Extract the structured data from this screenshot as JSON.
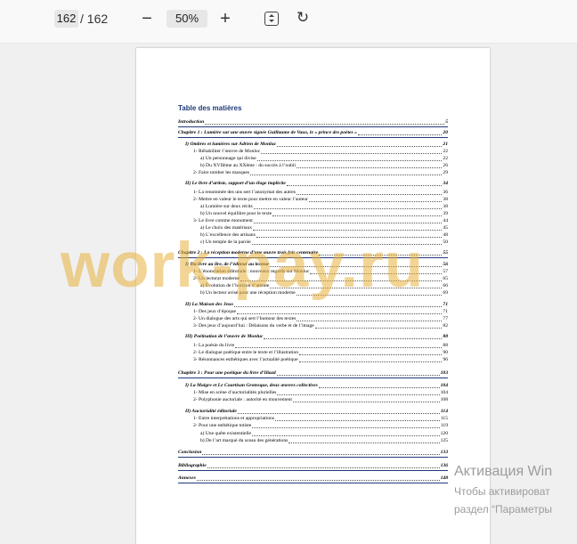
{
  "toolbar": {
    "page_current": "162",
    "page_separator": "/",
    "page_total": "162",
    "zoom_out_icon": "minus-icon",
    "zoom_level": "50%",
    "zoom_in_icon": "plus-icon",
    "fit_icon": "fit-page-icon",
    "rotate_icon": "rotate-icon"
  },
  "document": {
    "title": "Table des matières",
    "entries": [
      {
        "label": "Introduction",
        "page": "5",
        "kind": "chap"
      },
      {
        "label": "Chapitre 1 : Lumière sur une œuvre signée Guillaume de Vaux, le « prince des poètes »",
        "page": "20",
        "kind": "chap"
      },
      {
        "label": "I)      Ombres et lumières sur Adrien de Monluc",
        "page": "21",
        "kind": "sec"
      },
      {
        "label": "1-   Réhabiliter l’œuvre de Monluc",
        "page": "22",
        "kind": "sub"
      },
      {
        "label": "a)    Un personnage qui divise",
        "page": "22",
        "kind": "subsub"
      },
      {
        "label": "b)    Du XVIIème au XXème : du succès à l’oubli",
        "page": "26",
        "kind": "subsub"
      },
      {
        "label": "2-   Faire tomber les masques",
        "page": "29",
        "kind": "sub"
      },
      {
        "label": "II)     Le livre d’artiste, support d’un éloge implicite",
        "page": "34",
        "kind": "sec"
      },
      {
        "label": "1-   La renommée des uns sert l’anonymat des autres",
        "page": "36",
        "kind": "sub"
      },
      {
        "label": "2-   Mettre en valeur le texte pour mettre en valeur l’auteur",
        "page": "38",
        "kind": "sub"
      },
      {
        "label": "a)    Lumière sur deux récits",
        "page": "38",
        "kind": "subsub"
      },
      {
        "label": "b)    Un nouvel équilibre pour le texte",
        "page": "39",
        "kind": "subsub"
      },
      {
        "label": "3-   Le livre comme monument",
        "page": "44",
        "kind": "sub"
      },
      {
        "label": "a)    Le choix des matériaux",
        "page": "45",
        "kind": "subsub"
      },
      {
        "label": "b)    L’excellence des artisans",
        "page": "48",
        "kind": "subsub"
      },
      {
        "label": "c)    Un temple de la parole",
        "page": "50",
        "kind": "subsub"
      },
      {
        "label": "Chapitre 2 : La réception moderne d’une œuvre trois fois centenaire",
        "page": "55",
        "kind": "chap"
      },
      {
        "label": "I)      Du livre au lire, de l’éditeur au lecteur",
        "page": "56",
        "kind": "sec"
      },
      {
        "label": "1-   L’énonciation éditoriale : nouveaux regards sur Monluc",
        "page": "57",
        "kind": "sub"
      },
      {
        "label": "2-   Un lectorat moderne",
        "page": "65",
        "kind": "sub"
      },
      {
        "label": "a)    Évolution de l’horizon d’attente",
        "page": "66",
        "kind": "subsub"
      },
      {
        "label": "b)    Un lecteur avisé pour une réception moderne",
        "page": "69",
        "kind": "subsub"
      },
      {
        "label": "II)     La Maison des Jeux",
        "page": "71",
        "kind": "sec"
      },
      {
        "label": "1-   Des jeux d’époque",
        "page": "71",
        "kind": "sub"
      },
      {
        "label": "2-   Un dialogue des arts qui sert l’humour des textes",
        "page": "77",
        "kind": "sub"
      },
      {
        "label": "3-   Des jeux d’aujourd’hui : Délaisons du verbe et de l’image",
        "page": "82",
        "kind": "sub"
      },
      {
        "label": "III)    Poétisation de l’œuvre de Monluc",
        "page": "88",
        "kind": "sec"
      },
      {
        "label": "1-   La poésie du livre",
        "page": "88",
        "kind": "sub"
      },
      {
        "label": "2-   Le dialogue poétique entre le texte et l’illustration",
        "page": "90",
        "kind": "sub"
      },
      {
        "label": "3-   Résonnances esthétiques avec l’actualité poétique",
        "page": "96",
        "kind": "sub"
      },
      {
        "label": "Chapitre 3 : Pour une poétique du livre d’Iliazd",
        "page": "103",
        "kind": "chap"
      },
      {
        "label": "I)      La Maigre et Le Courtisan Grotesque, deux œuvres collectives",
        "page": "104",
        "kind": "sec"
      },
      {
        "label": "1-   Mise en scène d’auctorialités plurielles",
        "page": "104",
        "kind": "sub"
      },
      {
        "label": "2-   Polyphonie auctoriale : autorité en mouvement",
        "page": "108",
        "kind": "sub"
      },
      {
        "label": "II)     Auctorialité éditoriale",
        "page": "114",
        "kind": "sec"
      },
      {
        "label": "1- Entre interprétations et appropriations",
        "page": "115",
        "kind": "sub"
      },
      {
        "label": "2- Pour une esthétique totiste",
        "page": "119",
        "kind": "sub"
      },
      {
        "label": "a)    Une quête existentielle",
        "page": "120",
        "kind": "subsub"
      },
      {
        "label": "b)    De l’art marqué du sceau des générations",
        "page": "125",
        "kind": "subsub"
      },
      {
        "label": "Conclusion",
        "page": "133",
        "kind": "chap"
      },
      {
        "label": "Bibliographie",
        "page": "136",
        "kind": "chap"
      },
      {
        "label": "Annexes",
        "page": "148",
        "kind": "chap"
      }
    ]
  },
  "watermark": "work-pay.ru",
  "os_activation": {
    "line1": "Активация Win",
    "line2": "Чтобы активироват",
    "line3": "раздел “Параметры"
  }
}
